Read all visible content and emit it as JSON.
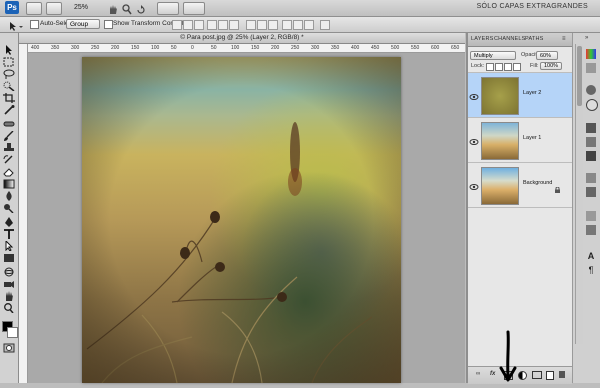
{
  "app": {
    "logo": "Ps",
    "zoom": "25%",
    "workspace": "SÓLO CAPAS EXTRAGRANDES"
  },
  "options": {
    "auto_select_label": "Auto-Select:",
    "auto_select_value": "Group",
    "show_transform_label": "Show Transform Controls"
  },
  "document": {
    "tab_title": "© Para post.jpg @ 25% (Layer 2, RGB/8) *",
    "ruler_marks": [
      "400",
      "350",
      "300",
      "250",
      "200",
      "150",
      "100",
      "50",
      "0",
      "50",
      "100",
      "150",
      "200",
      "250",
      "300",
      "350",
      "400",
      "450",
      "500",
      "550",
      "600",
      "650"
    ]
  },
  "layers_panel": {
    "tabs": [
      "LAYERS",
      "CHANNELS",
      "PATHS"
    ],
    "blend_mode": "Multiply",
    "opacity_label": "Opacity:",
    "opacity": "60%",
    "lock_label": "Lock:",
    "fill_label": "Fill:",
    "fill": "100%",
    "layers": [
      {
        "name": "Layer 2",
        "selected": true
      },
      {
        "name": "Layer 1",
        "selected": false
      },
      {
        "name": "Background",
        "selected": false
      }
    ]
  },
  "colors": {
    "selected_layer": "#b5d4f8",
    "ps_blue": "#1c63b7"
  }
}
